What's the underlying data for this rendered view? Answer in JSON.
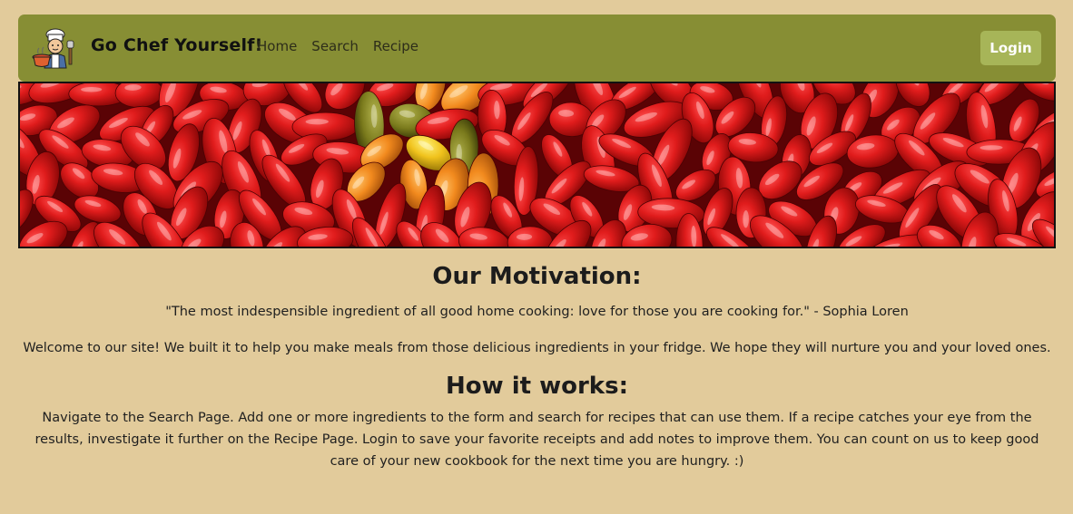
{
  "colors": {
    "page_background": "#e2cb9b",
    "navbar_background": "#878e34",
    "login_button": "#a7b558",
    "hero_border": "#111111"
  },
  "navbar": {
    "logo_icon": "chef-logo-icon",
    "brand_title": "Go Chef Yourself!",
    "links": [
      "Home",
      "Search",
      "Recipe"
    ],
    "login_label": "Login"
  },
  "hero": {
    "image_subject": "red-chili-peppers-banner"
  },
  "motivation": {
    "heading": "Our Motivation:",
    "quote": "\"The most indespensible ingredient of all good home cooking: love for those you are cooking for.\" - Sophia Loren",
    "welcome": "Welcome to our site! We built it to help you make meals from those delicious ingredients in your fridge. We hope they will nurture you and your loved ones."
  },
  "how_it_works": {
    "heading": "How it works:",
    "description": "Navigate to the Search Page. Add one or more ingredients to the form and search for recipes that can use them. If a recipe catches your eye from the results, investigate it further on the Recipe Page. Login to save your favorite receipts and add notes to improve them. You can count on us to keep good care of your new cookbook for the next time you are hungry. :)"
  }
}
